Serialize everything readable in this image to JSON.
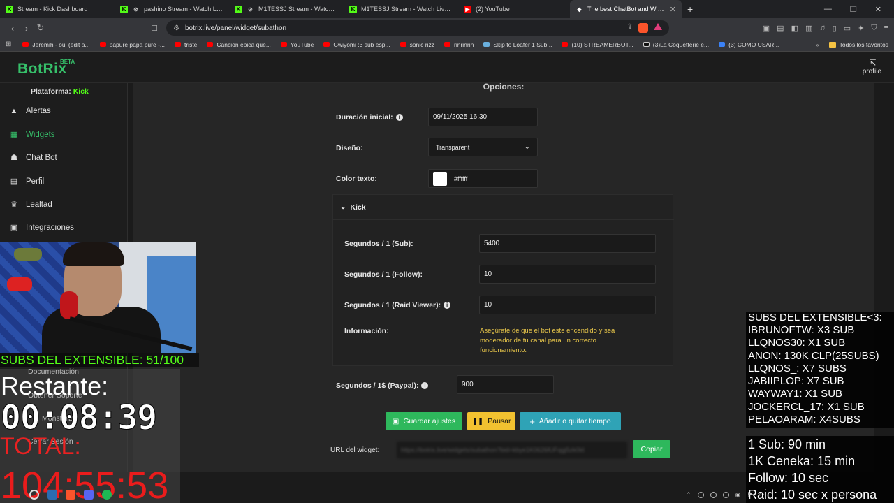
{
  "browser": {
    "tabs": [
      {
        "label": "Stream - Kick Dashboard",
        "icon": "kick-icon"
      },
      {
        "label": "pashino Stream - Watch Live on K",
        "icon": "kick-icon"
      },
      {
        "label": "M1TESSJ Stream - Watch Live on",
        "icon": "kick-icon"
      },
      {
        "label": "M1TESSJ Stream - Watch Live on Kick",
        "icon": "kick-icon"
      },
      {
        "label": "(2) YouTube",
        "icon": "youtube-icon"
      },
      {
        "label": "The best ChatBot and Widgets fo",
        "icon": "botrix-icon"
      }
    ],
    "url": "botrix.live/panel/widget/subathon",
    "bookmarks": [
      "Jeremih - oui (edit a...",
      "papure papa pure -...",
      "triste",
      "Cancion epica que...",
      "YouTube",
      "Gwiyomi :3 sub esp...",
      "sonic rizz",
      "rinrinrin",
      "Skip to Loafer 1 Sub...",
      "(10) STREAMERBOT...",
      "(3)La Coquetterie e...",
      "(3) COMO USAR..."
    ],
    "favorites_label": "Todos los favoritos"
  },
  "app": {
    "logo": "BotRix",
    "beta": "BETA",
    "profile": "profile"
  },
  "sidebar": {
    "platform_label": "Plataforma:",
    "platform_value": "Kick",
    "items": [
      {
        "label": "Alertas",
        "icon": "warning-icon"
      },
      {
        "label": "Widgets",
        "icon": "widgets-icon"
      },
      {
        "label": "Chat Bot",
        "icon": "robot-icon"
      },
      {
        "label": "Perfil",
        "icon": "profile-card-icon"
      },
      {
        "label": "Lealtad",
        "icon": "trophy-icon"
      },
      {
        "label": "Integraciones",
        "icon": "integrations-icon"
      }
    ],
    "hidden_items": [
      "Documentación",
      "Obtener Soporte",
      "MonsterBu",
      "Cerrar Sesión"
    ]
  },
  "form": {
    "section_title": "Opciones:",
    "initial_duration_label": "Duración inicial:",
    "initial_duration_value": "09/11/2025 16:30",
    "design_label": "Diseño:",
    "design_value": "Transparent",
    "text_color_label": "Color texto:",
    "text_color_value": "#ffffff",
    "kick_section": "Kick",
    "sub_label": "Segundos / 1 (Sub):",
    "sub_value": "5400",
    "follow_label": "Segundos / 1 (Follow):",
    "follow_value": "10",
    "raid_label": "Segundos / 1 (Raid Viewer):",
    "raid_value": "10",
    "info_label": "Información:",
    "info_text_1": "Asegúrate de que el bot este encendido y sea",
    "info_text_2": "moderador de tu canal para un correcto",
    "info_text_3": "funcionamiento.",
    "paypal_label": "Segundos / 1$ (Paypal):",
    "paypal_value": "900",
    "save_button": "Guardar ajustes",
    "pause_button": "Pausar",
    "time_button": "Añadir o quitar tiempo",
    "widget_url_label": "URL del widget:",
    "widget_url_value": "https://botrix.live/widgets/subathon?bid=kbye1K0626fUFqgj5zk0ld",
    "copy_button": "Copiar"
  },
  "overlay": {
    "subs_progress": "SUBS DEL EXTENSIBLE: 51/100",
    "remaining_label": "Restante:",
    "remaining_time": "00:08:39",
    "total_label": "TOTAL:",
    "total_time": "104:55:53",
    "subs_list_title": "SUBS DEL EXTENSIBLE<3:",
    "subs_list": [
      "IBRUNOFTW: X3 SUB",
      "LLQNOS30: X1 SUB",
      "ANON: 130K CLP(25SUBS)",
      "LLQNOS_: X7 SUBS",
      "JABIIPLOP: X7 SUB",
      "WAYWAY1: X1 SUB",
      "JOCKERCL_17: X1 SUB",
      "PELAOARAM: X4SUBS"
    ],
    "rules": [
      "1 Sub: 90 min",
      "1K Ceneka: 15 min",
      "Follow: 10 sec",
      "Raid: 10 sec x persona"
    ]
  },
  "colors": {
    "brand_green": "#36c06a",
    "kick_green": "#53fc18",
    "pause_yellow": "#f2c230",
    "time_teal": "#2fa3b6",
    "timer_red": "#ff1a1a"
  }
}
